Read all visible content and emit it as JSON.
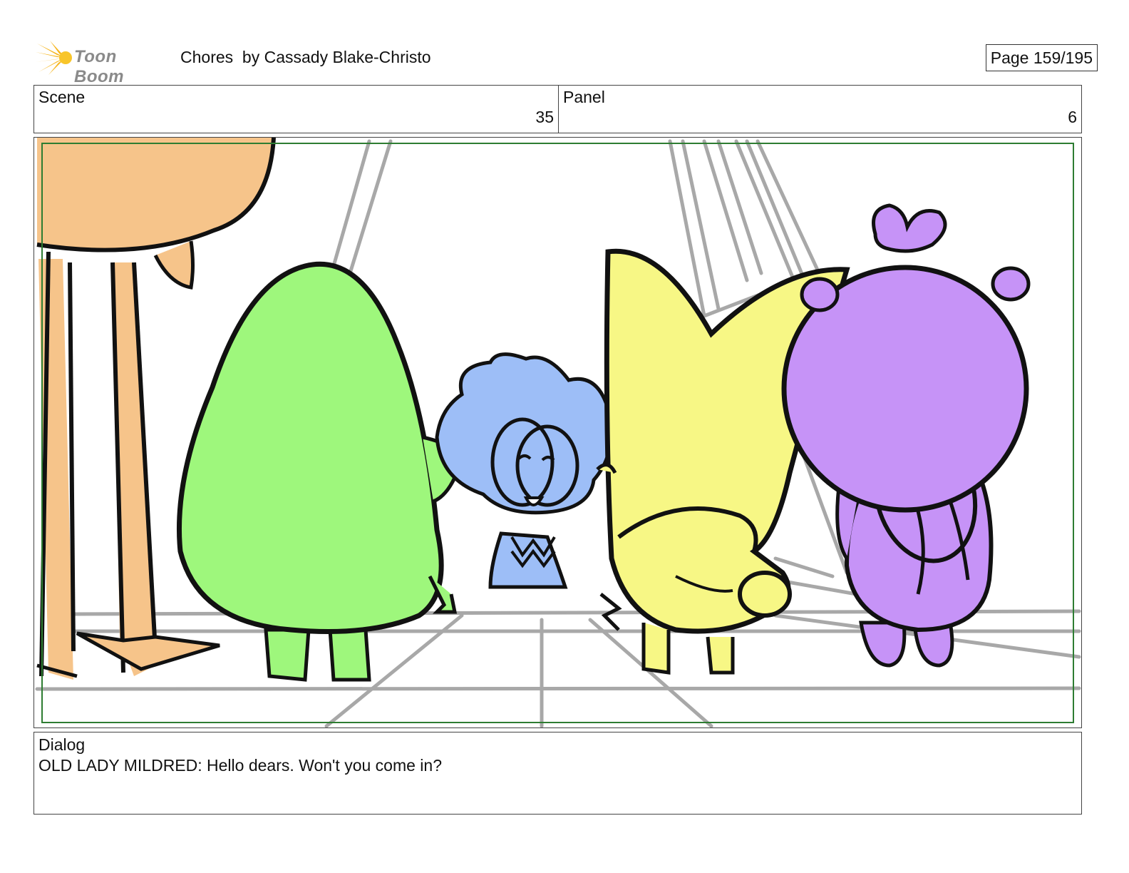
{
  "header": {
    "logo_text": "Toon Boom",
    "title": "Chores  by Cassady Blake-Christo",
    "page": "Page 159/195"
  },
  "info": {
    "scene_label": "Scene",
    "scene_value": "35",
    "panel_label": "Panel",
    "panel_value": "6"
  },
  "dialog": {
    "label": "Dialog",
    "text": "OLD LADY MILDRED: Hello dears. Won't you come in?"
  },
  "colors": {
    "green_character": "#9ef77c",
    "blue_character": "#9dbef7",
    "yellow_character": "#f7f785",
    "purple_character": "#c693f7",
    "orange_character": "#f6c48a",
    "safe_frame": "#2e7d32",
    "background_lines": "#a8a8a8"
  }
}
